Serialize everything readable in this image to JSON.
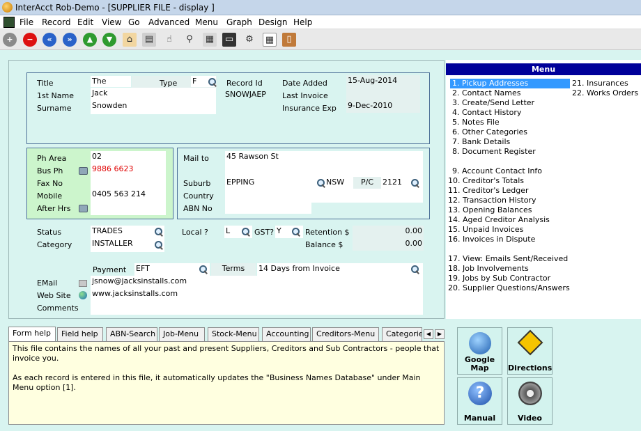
{
  "window": {
    "title": "InterAcct Rob-Demo - [SUPPLIER FILE - display ]"
  },
  "menubar": [
    "File",
    "Record",
    "Edit",
    "View",
    "Go",
    "Advanced",
    "Menu",
    "Graph",
    "Design",
    "Help"
  ],
  "record": {
    "title_label": "Title",
    "title_value": "The",
    "type_label": "Type",
    "type_value": "F",
    "record_id_label": "Record Id",
    "record_id_value": "SNOWJAEP",
    "date_added_label": "Date Added",
    "date_added_value": "15-Aug-2014",
    "last_invoice_label": "Last Invoice",
    "insurance_exp_label": "Insurance Exp",
    "insurance_exp_value": "9-Dec-2010",
    "first_name_label": "1st Name",
    "first_name_value": "Jack",
    "surname_label": "Surname",
    "surname_value": "Snowden"
  },
  "phones": {
    "ph_area_label": "Ph Area",
    "ph_area_value": "02",
    "bus_ph_label": "Bus Ph",
    "bus_ph_value": "9886 6623",
    "fax_label": "Fax No",
    "mobile_label": "Mobile",
    "mobile_value": "0405 563 214",
    "after_hrs_label": "After Hrs"
  },
  "address": {
    "mail_to_label": "Mail to",
    "mail_to_value": "45 Rawson St",
    "suburb_label": "Suburb",
    "suburb_value": "EPPING",
    "state_value": "NSW",
    "pc_label": "P/C",
    "pc_value": "2121",
    "country_label": "Country",
    "abn_label": "ABN No"
  },
  "status": {
    "status_label": "Status",
    "status_value": "TRADES",
    "category_label": "Category",
    "category_value": "INSTALLER",
    "local_label": "Local ?",
    "local_value": "L",
    "gst_label": "GST?",
    "gst_value": "Y",
    "retention_label": "Retention $",
    "retention_value": "0.00",
    "balance_label": "Balance  $",
    "balance_value": "0.00"
  },
  "payment": {
    "payment_label": "Payment",
    "payment_value": "EFT",
    "terms_label": "Terms",
    "terms_value": "14 Days from Invoice"
  },
  "contact": {
    "email_label": "EMail",
    "email_value": "jsnow@jacksinstalls.com",
    "website_label": "Web Site",
    "website_value": "www.jacksinstalls.com",
    "comments_label": "Comments"
  },
  "menu": {
    "header": "Menu",
    "items_left": [
      "1. Pickup Addresses",
      "2. Contact Names",
      "3. Create/Send Letter",
      "4. Contact History",
      "5. Notes File",
      "6. Other Categories",
      "7. Bank Details",
      "8. Document Register",
      "9. Account Contact Info",
      "10. Creditor's Totals",
      "11. Creditor's Ledger",
      "12. Transaction History",
      "13. Opening Balances",
      "14. Aged Creditor Analysis",
      "15. Unpaid Invoices",
      "16. Invoices in Dispute",
      "17. View: Emails Sent/Received",
      "18. Job Involvements",
      "19. Jobs by Sub Contractor",
      "20. Supplier Questions/Answers"
    ],
    "items_right": [
      "21. Insurances",
      "22. Works Orders"
    ]
  },
  "tabs": [
    "Form help",
    "Field help",
    "ABN-Search",
    "Job-Menu",
    "Stock-Menu",
    "Accounting",
    "Creditors-Menu",
    "Categorie"
  ],
  "help_text": [
    "This file contains the names of all your past and present Suppliers, Creditors and Sub Contractors - people that invoice you.",
    "As each record is entered in this file, it automatically updates the \"Business Names Database\" under Main Menu option [1]."
  ],
  "buttons": {
    "google_map": "Google Map",
    "directions": "Directions",
    "manual": "Manual",
    "video": "Video"
  },
  "colors": {
    "menu_header": "#000099",
    "menu_selected": "#3399ff",
    "phone_group": "#ccf5cc",
    "help_bg": "#ffffe0",
    "bus_phone": "#e00000"
  }
}
